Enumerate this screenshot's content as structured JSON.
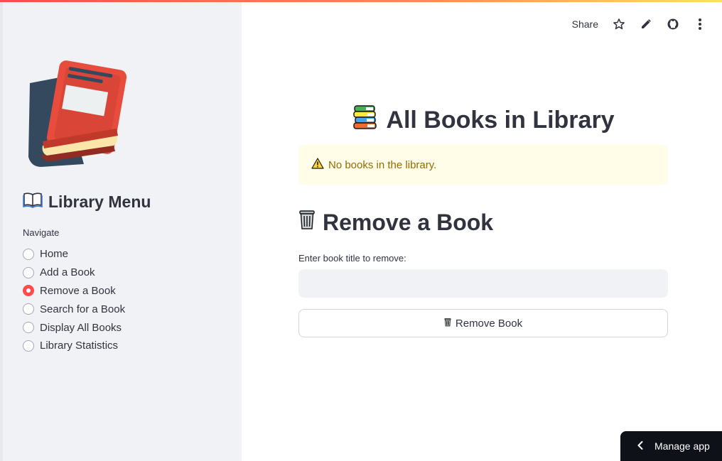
{
  "sidebar": {
    "logo_icon": "library-book-logo",
    "menu_title": "Library Menu",
    "menu_title_icon": "open-book-icon",
    "nav_label": "Navigate",
    "items": [
      {
        "label": "Home",
        "selected": false
      },
      {
        "label": "Add a Book",
        "selected": false
      },
      {
        "label": "Remove a Book",
        "selected": true
      },
      {
        "label": "Search for a Book",
        "selected": false
      },
      {
        "label": "Display All Books",
        "selected": false
      },
      {
        "label": "Library Statistics",
        "selected": false
      }
    ]
  },
  "toolbar": {
    "share_label": "Share",
    "icons": [
      "star-icon",
      "pencil-icon",
      "github-icon",
      "more-vertical-icon"
    ]
  },
  "main": {
    "heading": "All Books in Library",
    "heading_icon": "books-stack-icon",
    "warning_text": "No books in the library.",
    "warning_icon": "warning-icon",
    "section_title": "Remove a Book",
    "section_icon": "trash-can-icon",
    "input_label": "Enter book title to remove:",
    "input_value": "",
    "button_label": "Remove Book",
    "button_icon": "trash-can-icon"
  },
  "footer": {
    "manage_label": "Manage app"
  },
  "colors": {
    "accent": "#ff4b4b",
    "sidebar_bg": "#f0f2f6",
    "warning_bg": "#fffce7",
    "warning_text": "#926c05",
    "manage_bg": "#0e1117"
  }
}
